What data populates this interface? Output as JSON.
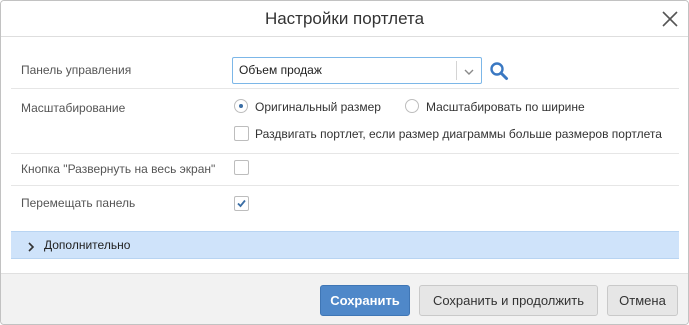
{
  "dialog": {
    "title": "Настройки портлета"
  },
  "panel": {
    "label": "Панель управления",
    "selected_value": "Объем продаж"
  },
  "scaling": {
    "label": "Масштабирование",
    "option_original": "Оригинальный размер",
    "option_fit_width": "Масштабировать по ширине",
    "selected": "original",
    "expand_label": "Раздвигать портлет, если размер диаграммы больше размеров портлета",
    "expand_checked": false
  },
  "fullscreen": {
    "label": "Кнопка \"Развернуть на весь экран\"",
    "checked": false
  },
  "move_panel": {
    "label": "Перемещать панель",
    "checked": true
  },
  "advanced": {
    "label": "Дополнительно"
  },
  "footer": {
    "save_label": "Сохранить",
    "save_continue_label": "Сохранить и продолжить",
    "cancel_label": "Отмена"
  },
  "colors": {
    "primary_button": "#4f88c9",
    "section_highlight": "#cfe3fa",
    "focus_border": "#7cb7e8"
  }
}
